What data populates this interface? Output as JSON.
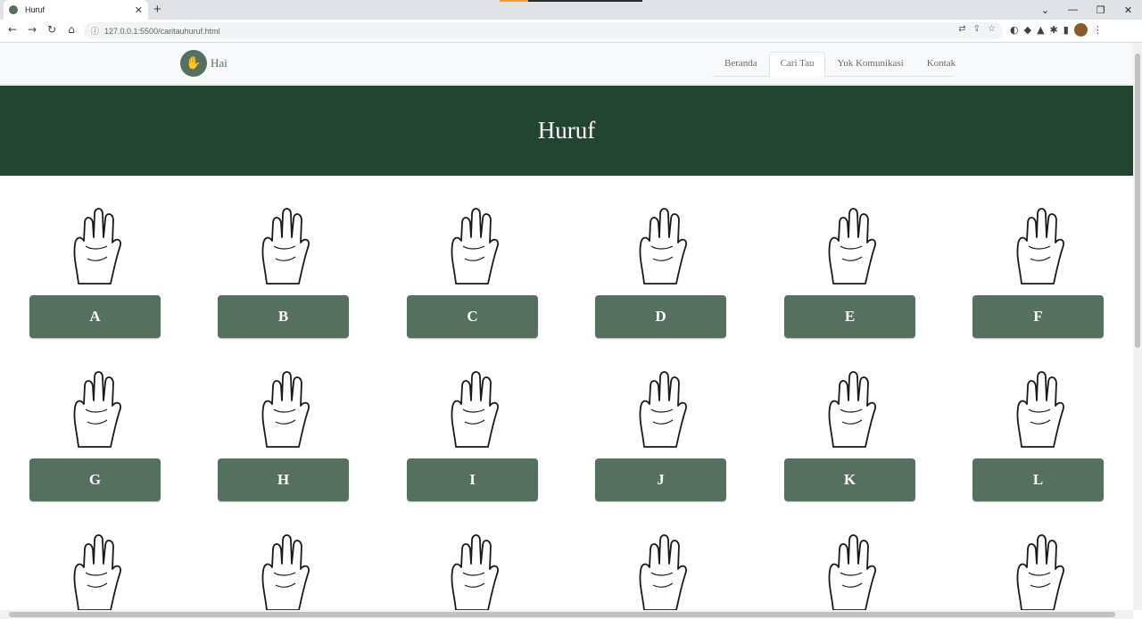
{
  "browser": {
    "tab_title": "Huruf",
    "tab_close": "✕",
    "new_tab": "+",
    "url": "127.0.0.1:5500/caritauhuruf.html",
    "window_controls": [
      "⌄",
      "—",
      "❐",
      "✕"
    ]
  },
  "navbar": {
    "brand_text": "Hai",
    "links": [
      {
        "label": "Beranda"
      },
      {
        "label": "Cari Tau"
      },
      {
        "label": "Yuk Komunikasi"
      },
      {
        "label": "Kontak"
      }
    ],
    "active_link": "Cari Tau"
  },
  "hero": {
    "title": "Huruf"
  },
  "letters": [
    "A",
    "B",
    "C",
    "D",
    "E",
    "F",
    "G",
    "H",
    "I",
    "J",
    "K",
    "L"
  ],
  "colors": {
    "accent": "#55705f",
    "hero_bg": "#224431",
    "button_text": "#ffffff"
  }
}
